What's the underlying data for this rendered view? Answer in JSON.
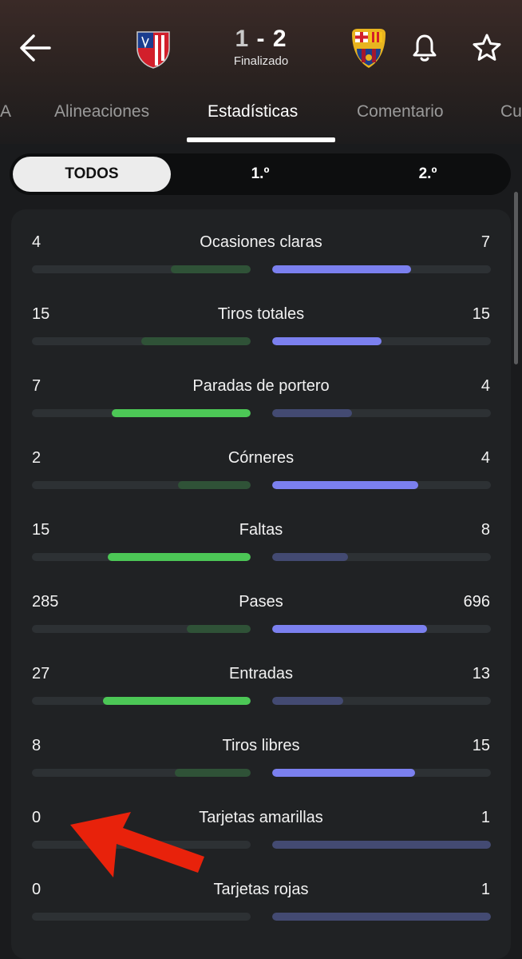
{
  "match": {
    "home_score": "1",
    "separator": "-",
    "away_score": "2",
    "status": "Finalizado"
  },
  "tabs": [
    {
      "label": "A"
    },
    {
      "label": "Alineaciones"
    },
    {
      "label": "Estadísticas",
      "active": true
    },
    {
      "label": "Comentario"
    },
    {
      "label": "Cu"
    }
  ],
  "periods": [
    {
      "label": "TODOS",
      "active": true
    },
    {
      "label": "1.º"
    },
    {
      "label": "2.º"
    }
  ],
  "colors": {
    "home_strong": "#4cc756",
    "home_weak": "#2f5237",
    "away_strong": "#7b80ef",
    "away_weak": "#434a72"
  },
  "icons": {
    "back": "arrow-left-icon",
    "home_crest": "atletico-madrid-crest-icon",
    "away_crest": "fc-barcelona-crest-icon",
    "bell": "bell-icon",
    "star": "star-icon",
    "annotation": "red-arrow-icon"
  },
  "stats": [
    {
      "label": "Ocasiones claras",
      "home": 4,
      "away": 7
    },
    {
      "label": "Tiros totales",
      "home": 15,
      "away": 15
    },
    {
      "label": "Paradas de portero",
      "home": 7,
      "away": 4
    },
    {
      "label": "Córneres",
      "home": 2,
      "away": 4
    },
    {
      "label": "Faltas",
      "home": 15,
      "away": 8
    },
    {
      "label": "Pases",
      "home": 285,
      "away": 696
    },
    {
      "label": "Entradas",
      "home": 27,
      "away": 13
    },
    {
      "label": "Tiros libres",
      "home": 8,
      "away": 15
    },
    {
      "label": "Tarjetas amarillas",
      "home": 0,
      "away": 1
    },
    {
      "label": "Tarjetas rojas",
      "home": 0,
      "away": 1
    }
  ]
}
